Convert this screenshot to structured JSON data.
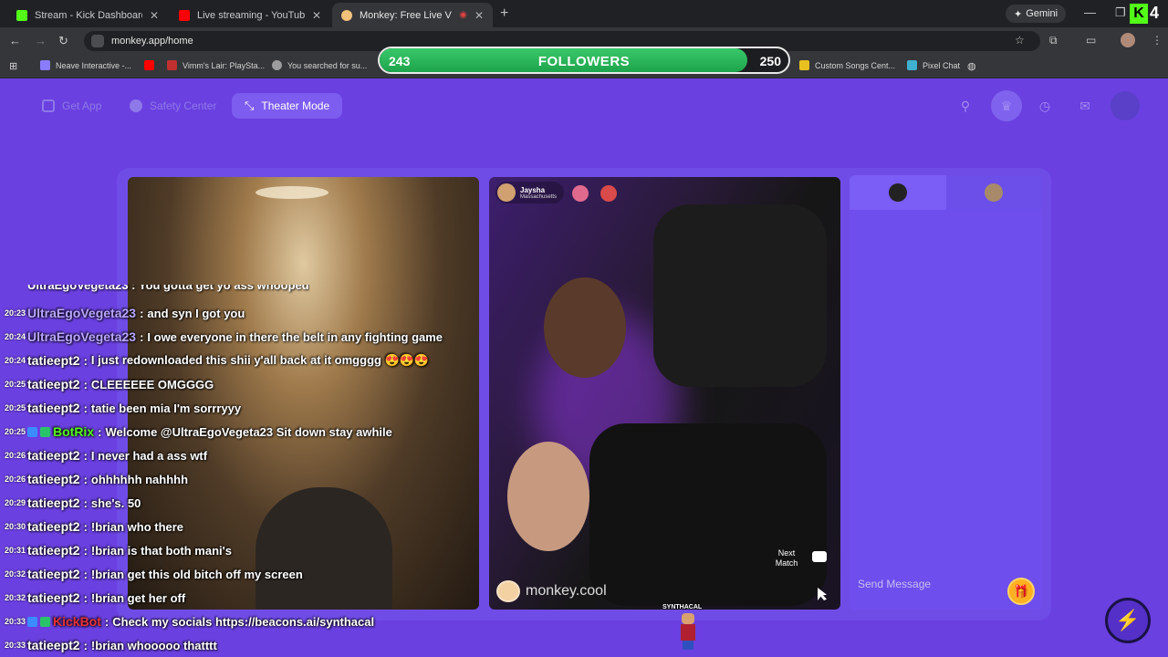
{
  "browser": {
    "tabs": [
      {
        "title": "Stream - Kick Dashboard",
        "color": "#53fc18"
      },
      {
        "title": "Live streaming - YouTube Studio",
        "color": "#ff0000"
      },
      {
        "title": "Monkey: Free Live Video Chat",
        "color": "#f3c27a"
      }
    ],
    "gemini_label": "Gemini",
    "url": "monkey.app/home",
    "overlay_logo_letter": "K",
    "overlay_number": "4",
    "bookmarks": [
      {
        "label": "Neave Interactive -...",
        "color": "#8a7cff"
      },
      {
        "label": "",
        "color": "#ff0000"
      },
      {
        "label": "Vimm's Lair: PlaySta...",
        "color": "#c03030"
      },
      {
        "label": "You searched for su...",
        "color": "#9c9c9c"
      },
      {
        "label": "Custom Songs Cent...",
        "color": "#e8c020"
      },
      {
        "label": "Pixel Chat",
        "color": "#3fb0d0"
      }
    ]
  },
  "followers_bar": {
    "current": "243",
    "label": "FOLLOWERS",
    "goal": "250",
    "progress": 0.9
  },
  "monkey": {
    "get_app": "Get App",
    "safety_center": "Safety Center",
    "theater_mode": "Theater Mode",
    "match_user": {
      "name": "Jaysha",
      "location": "Massachusetts"
    },
    "next_match": "Next Match",
    "watermark": "monkey.cool",
    "send_placeholder": "Send Message"
  },
  "stream_chat": {
    "cut_off_line": "UltraEgoVegeta23 : You gotta get yo ass whooped",
    "lines": [
      {
        "time": "20:23",
        "user": "UltraEgoVegeta23",
        "color": "#b9a6ff",
        "text": "and syn I got you",
        "badges": []
      },
      {
        "time": "20:24",
        "user": "UltraEgoVegeta23",
        "color": "#b9a6ff",
        "text": "I owe everyone in there the belt in any fighting game",
        "badges": []
      },
      {
        "time": "20:24",
        "user": "tatieept2",
        "color": "#ffffff",
        "text": "I just redownloaded this shii y'all back at it omgggg 😍😍😍",
        "badges": []
      },
      {
        "time": "20:25",
        "user": "tatieept2",
        "color": "#ffffff",
        "text": "CLEEEEEE OMGGGG",
        "badges": []
      },
      {
        "time": "20:25",
        "user": "tatieept2",
        "color": "#ffffff",
        "text": "tatie been mia I'm sorrryyy",
        "badges": []
      },
      {
        "time": "20:25",
        "user": "BotRix",
        "color": "#53fc18",
        "text": "Welcome @UltraEgoVegeta23 Sit down stay awhile",
        "badges": [
          "#3a8cff",
          "#29c46a"
        ]
      },
      {
        "time": "20:26",
        "user": "tatieept2",
        "color": "#ffffff",
        "text": "I never had a ass wtf",
        "badges": []
      },
      {
        "time": "20:26",
        "user": "tatieept2",
        "color": "#ffffff",
        "text": "ohhhhhh nahhhh",
        "badges": []
      },
      {
        "time": "20:29",
        "user": "tatieept2",
        "color": "#ffffff",
        "text": "she's. 50",
        "badges": []
      },
      {
        "time": "20:30",
        "user": "tatieept2",
        "color": "#ffffff",
        "text": "!brian who there",
        "badges": []
      },
      {
        "time": "20:31",
        "user": "tatieept2",
        "color": "#ffffff",
        "text": "!brian is that both mani's",
        "badges": []
      },
      {
        "time": "20:32",
        "user": "tatieept2",
        "color": "#ffffff",
        "text": "!brian get this old bitch off my screen",
        "badges": []
      },
      {
        "time": "20:32",
        "user": "tatieept2",
        "color": "#ffffff",
        "text": "!brian get her off",
        "badges": []
      },
      {
        "time": "20:33",
        "user": "KickBot",
        "color": "#e8303a",
        "text": "Check my socials https://beacons.ai/synthacal",
        "badges": [
          "#3a8cff",
          "#29c46a"
        ]
      },
      {
        "time": "20:33",
        "user": "tatieept2",
        "color": "#ffffff",
        "text": "!brian whooooo thatttt",
        "badges": []
      }
    ]
  },
  "streamer_tag": "SYNTHACAL"
}
